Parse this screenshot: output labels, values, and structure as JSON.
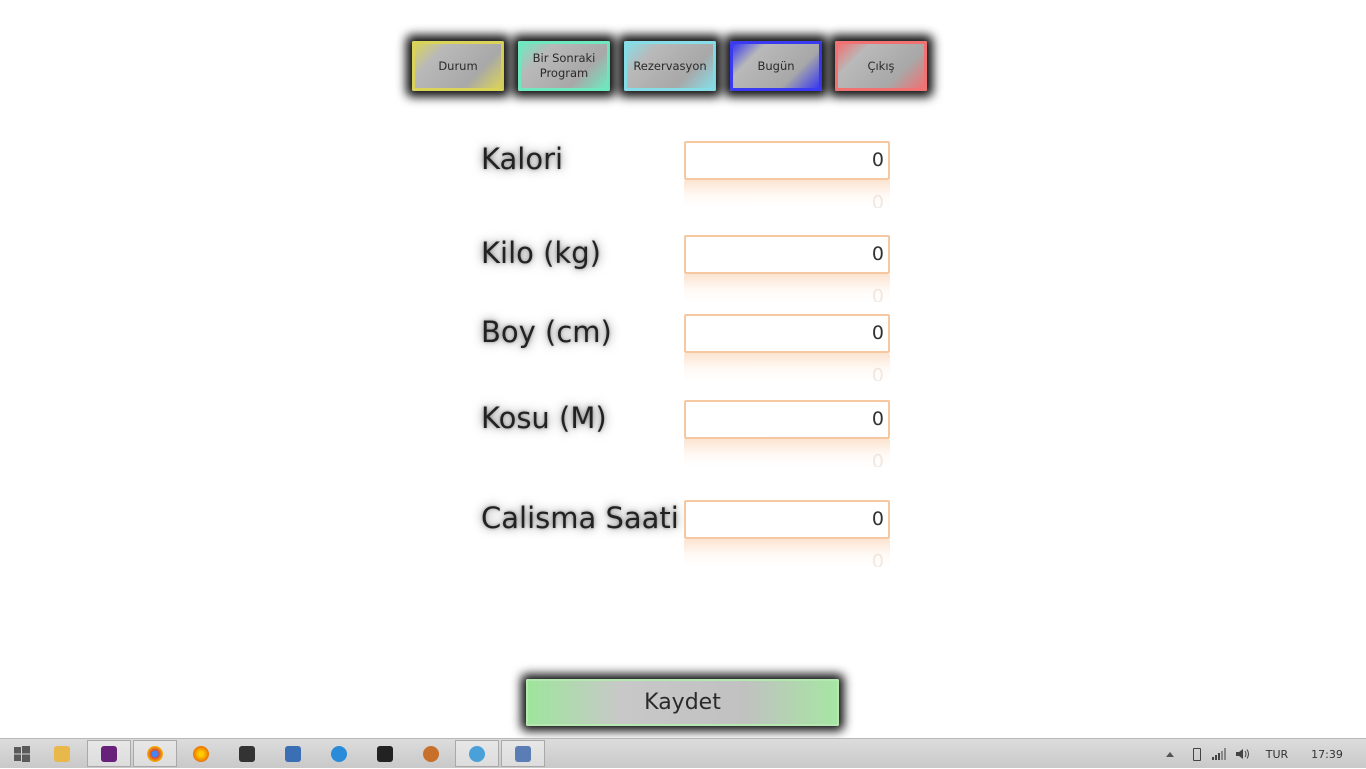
{
  "nav": {
    "durum": "Durum",
    "next_program": "Bir Sonraki\nProgram",
    "rezervasyon": "Rezervasyon",
    "bugun": "Bugün",
    "cikis": "Çıkış"
  },
  "nav_colors": {
    "durum": "#d9d35a",
    "next_program": "#6fe8c0",
    "rezervasyon": "#86dde8",
    "bugun": "#3a3af0",
    "cikis": "#f07272"
  },
  "form": {
    "fields": [
      {
        "label": "Kalori",
        "value": "0"
      },
      {
        "label": "Kilo (kg)",
        "value": "0"
      },
      {
        "label": "Boy (cm)",
        "value": "0"
      },
      {
        "label": "Kosu (M)",
        "value": "0"
      },
      {
        "label": "Calisma Saati",
        "value": "0"
      }
    ],
    "save_label": "Kaydet"
  },
  "taskbar": {
    "items": [
      {
        "name": "start-icon",
        "color": "#1e90ff"
      },
      {
        "name": "file-explorer-icon",
        "color": "#e8b84a"
      },
      {
        "name": "visual-studio-icon",
        "color": "#68217a"
      },
      {
        "name": "chrome-icon",
        "color": "#db4437"
      },
      {
        "name": "firefox-icon",
        "color": "#e66000"
      },
      {
        "name": "console-icon",
        "color": "#333333"
      },
      {
        "name": "virtualbox-icon",
        "color": "#3a6fb5"
      },
      {
        "name": "torrent-icon",
        "color": "#2a8bd8"
      },
      {
        "name": "rss-icon",
        "color": "#222222"
      },
      {
        "name": "media-player-icon",
        "color": "#c8702a"
      },
      {
        "name": "paint-icon",
        "color": "#4aa0d8"
      },
      {
        "name": "java-app-icon",
        "color": "#5b7db5"
      }
    ],
    "tray": {
      "language": "TUR",
      "time": "17:39"
    }
  }
}
